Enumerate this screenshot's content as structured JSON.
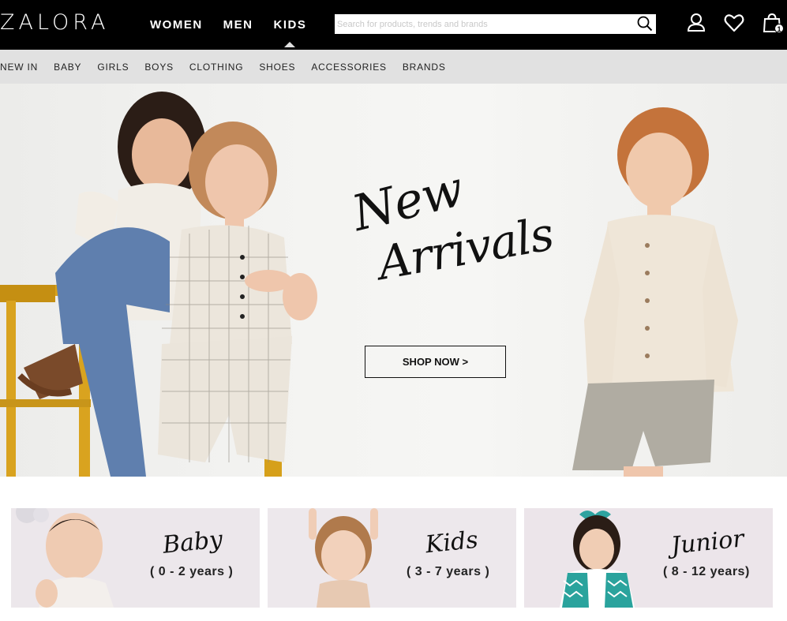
{
  "brand": {
    "logo": "ZALORA"
  },
  "gender_nav": [
    {
      "label": "WOMEN"
    },
    {
      "label": "MEN"
    },
    {
      "label": "KIDS"
    }
  ],
  "search": {
    "placeholder": "Search for products, trends and brands"
  },
  "cart": {
    "count": "1"
  },
  "subnav": [
    {
      "label": "NEW IN"
    },
    {
      "label": "BABY"
    },
    {
      "label": "GIRLS"
    },
    {
      "label": "BOYS"
    },
    {
      "label": "CLOTHING"
    },
    {
      "label": "SHOES"
    },
    {
      "label": "ACCESSORIES"
    },
    {
      "label": "BRANDS"
    }
  ],
  "hero": {
    "headline_line1": "New",
    "headline_line2": "Arrivals",
    "cta": "SHOP NOW >"
  },
  "tiles": [
    {
      "title": "Baby",
      "subtitle": "( 0 - 2 years )"
    },
    {
      "title": "Kids",
      "subtitle": "( 3 - 7 years )"
    },
    {
      "title": "Junior",
      "subtitle": "( 8 - 12 years)"
    }
  ],
  "icons": {
    "search": "search-icon",
    "account": "user-icon",
    "wishlist": "heart-icon",
    "cart": "shopping-bag-icon"
  },
  "colors": {
    "topbar": "#000000",
    "subnav": "#e1e1e1",
    "tile_bg": "#ece8ec"
  }
}
